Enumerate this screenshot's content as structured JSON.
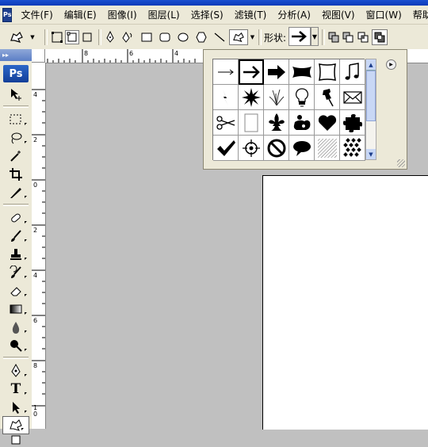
{
  "app": {
    "logo_text": "Ps"
  },
  "menu": [
    {
      "label": "文件(F)"
    },
    {
      "label": "编辑(E)"
    },
    {
      "label": "图像(I)"
    },
    {
      "label": "图层(L)"
    },
    {
      "label": "选择(S)"
    },
    {
      "label": "滤镜(T)"
    },
    {
      "label": "分析(A)"
    },
    {
      "label": "视图(V)"
    },
    {
      "label": "窗口(W)"
    },
    {
      "label": "帮助"
    }
  ],
  "options": {
    "shape_label": "形状:",
    "selected_shape_icon": "arrow-icon"
  },
  "toolbox": {
    "header_glyph": "▸▸",
    "tools": [
      "move-tool-icon",
      "marquee-tool-icon",
      "lasso-tool-icon",
      "magic-wand-tool-icon",
      "crop-tool-icon",
      "slice-tool-icon",
      "healing-brush-tool-icon",
      "brush-tool-icon",
      "clone-stamp-tool-icon",
      "history-brush-tool-icon",
      "eraser-tool-icon",
      "gradient-tool-icon",
      "blur-tool-icon",
      "dodge-tool-icon",
      "pen-tool-icon",
      "type-tool-icon",
      "path-selection-tool-icon",
      "custom-shape-tool-icon"
    ],
    "type_tool_label": "T"
  },
  "rulers": {
    "top_labels": [
      "8",
      "6",
      "4"
    ],
    "left_labels": [
      "4",
      "2",
      "0",
      "2",
      "4",
      "6",
      "8",
      "1 0"
    ]
  },
  "shape_picker": {
    "shapes": [
      "thin-arrow-icon",
      "bold-arrow-icon",
      "heavy-arrow-icon",
      "banner-icon",
      "frame-icon",
      "music-note-icon",
      "lightning-icon",
      "starburst-icon",
      "grass-icon",
      "lightbulb-icon",
      "pushpin-icon",
      "envelope-icon",
      "scissors-icon",
      "blank-frame-icon",
      "fleur-de-lis-icon",
      "puzzle-figure-icon",
      "heart-icon",
      "puzzle-piece-icon",
      "checkmark-icon",
      "target-icon",
      "prohibited-icon",
      "speech-bubble-icon",
      "hatched-square-icon",
      "checker-diamond-icon"
    ],
    "selected_index": 1
  }
}
